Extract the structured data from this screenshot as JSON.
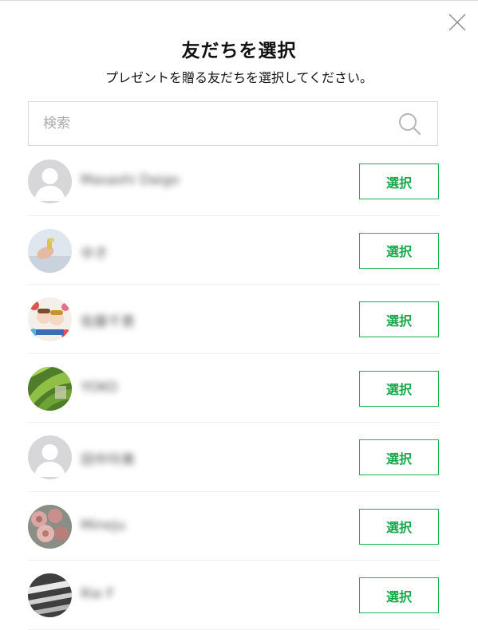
{
  "dialog": {
    "title": "友だちを選択",
    "subtitle": "プレゼントを贈る友だちを選択してください。"
  },
  "search": {
    "placeholder": "検索",
    "value": ""
  },
  "colors": {
    "accent_green": "#1fb155",
    "border_gray": "#d6d6d6",
    "divider_gray": "#efefef"
  },
  "friends": [
    {
      "name": "Masashi Daigo",
      "select_label": "選択",
      "avatar": "default-avatar"
    },
    {
      "name": "ゆき",
      "select_label": "選択",
      "avatar": "photo-hand"
    },
    {
      "name": "佐藤千恵",
      "select_label": "選択",
      "avatar": "photo-illustration"
    },
    {
      "name": "YOKO",
      "select_label": "選択",
      "avatar": "photo-leaves"
    },
    {
      "name": "田中玲美",
      "select_label": "選択",
      "avatar": "default-avatar"
    },
    {
      "name": "Mineju",
      "select_label": "選択",
      "avatar": "photo-flowers"
    },
    {
      "name": "Rie F",
      "select_label": "選択",
      "avatar": "photo-pattern"
    }
  ]
}
